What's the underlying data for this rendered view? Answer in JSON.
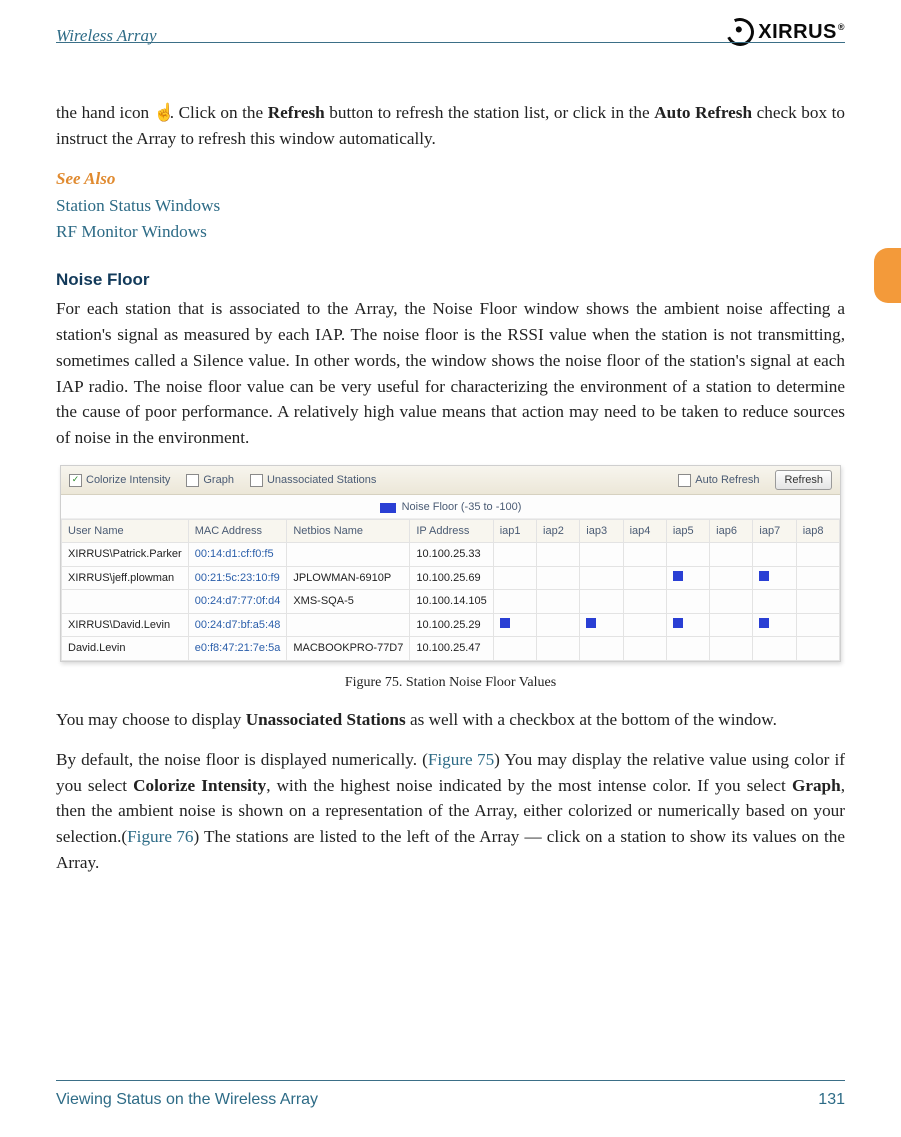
{
  "header": {
    "doc_title": "Wireless Array",
    "brand": "XIRRUS",
    "brand_mark": "®"
  },
  "intro": {
    "pre_hand": "the hand icon ",
    "post_hand_a": ". Click on the ",
    "refresh_bold": "Refresh",
    "post_hand_b": " button to refresh the station list, or click in the ",
    "auto_refresh_bold": "Auto Refresh",
    "post_hand_c": " check box to instruct the Array to refresh this window automatically."
  },
  "see_also": {
    "heading": "See Also",
    "links": [
      "Station Status Windows",
      "RF Monitor Windows"
    ]
  },
  "section": {
    "heading": "Noise Floor",
    "body": "For each station that is associated to the Array, the Noise Floor window shows the ambient noise affecting a station's signal as measured by each IAP. The noise floor is the RSSI value when the station is not transmitting, sometimes called a Silence value. In other words, the window shows the noise floor of the station's signal at each IAP radio. The noise floor value can be very useful for characterizing the environment of a station to determine the cause of poor performance. A relatively high value means that action may need to be taken to reduce sources of noise in the environment."
  },
  "ui": {
    "checks": {
      "colorize": "Colorize Intensity",
      "graph": "Graph",
      "unassoc": "Unassociated Stations",
      "autorefresh": "Auto Refresh"
    },
    "refresh_btn": "Refresh",
    "legend": "Noise Floor (-35 to -100)",
    "cols": [
      "User Name",
      "MAC Address",
      "Netbios Name",
      "IP Address",
      "iap1",
      "iap2",
      "iap3",
      "iap4",
      "iap5",
      "iap6",
      "iap7",
      "iap8"
    ],
    "rows": [
      {
        "user": "XIRRUS\\Patrick.Parker",
        "mac": "00:14:d1:cf:f0:f5",
        "nb": "",
        "ip": "10.100.25.33",
        "iaps": [
          "",
          "",
          "",
          "",
          "",
          "",
          "",
          ""
        ]
      },
      {
        "user": "XIRRUS\\jeff.plowman",
        "mac": "00:21:5c:23:10:f9",
        "nb": "JPLOWMAN-6910P",
        "ip": "10.100.25.69",
        "iaps": [
          "",
          "",
          "",
          "",
          "1",
          "",
          "1",
          ""
        ]
      },
      {
        "user": "",
        "mac": "00:24:d7:77:0f:d4",
        "nb": "XMS-SQA-5",
        "ip": "10.100.14.105",
        "iaps": [
          "",
          "",
          "",
          "",
          "",
          "",
          "",
          ""
        ]
      },
      {
        "user": "XIRRUS\\David.Levin",
        "mac": "00:24:d7:bf:a5:48",
        "nb": "",
        "ip": "10.100.25.29",
        "iaps": [
          "1",
          "",
          "1",
          "",
          "1",
          "",
          "1",
          ""
        ]
      },
      {
        "user": "David.Levin",
        "mac": "e0:f8:47:21:7e:5a",
        "nb": "MACBOOKPRO-77D7",
        "ip": "10.100.25.47",
        "iaps": [
          "",
          "",
          "",
          "",
          "",
          "",
          "",
          ""
        ]
      }
    ]
  },
  "figcap": "Figure 75. Station Noise Floor Values",
  "para2": {
    "a": "You may choose to display ",
    "b_bold": "Unassociated Stations",
    "c": " as well with a checkbox at the bottom of the window."
  },
  "para3": {
    "a": "By default, the noise floor is displayed numerically. (",
    "fig75": "Figure 75",
    "b": ") You may display the relative value using color if you select ",
    "colorize_bold": "Colorize Intensity",
    "c": ", with the highest noise indicated by the most intense color. If you select ",
    "graph_bold": "Graph",
    "d": ", then the ambient noise is shown on a representation of the Array, either colorized or numerically based on your selection.(",
    "fig76": "Figure 76",
    "e": ") The stations are listed to the left of the Array — click on a station to show its values on the Array."
  },
  "footer": {
    "left": "Viewing Status on the Wireless Array",
    "right": "131"
  }
}
